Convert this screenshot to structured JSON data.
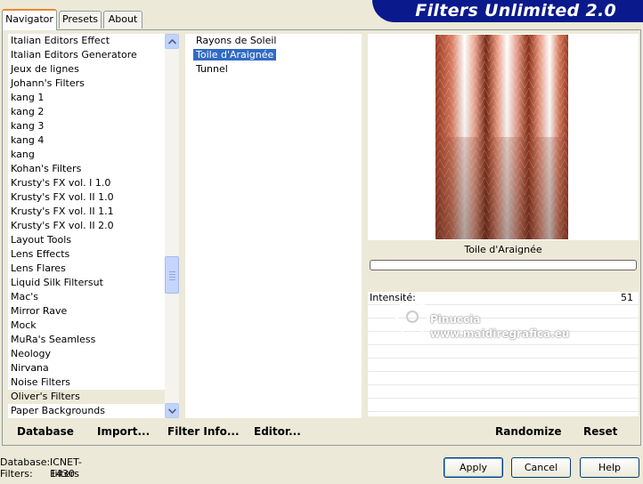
{
  "app": {
    "title": "Filters Unlimited 2.0"
  },
  "tabs": [
    {
      "label": "Navigator",
      "active": true
    },
    {
      "label": "Presets",
      "active": false
    },
    {
      "label": "About",
      "active": false
    }
  ],
  "categories": {
    "items": [
      "Italian Editors Effect",
      "Italian Editors Generatore",
      "Jeux de lignes",
      "Johann's Filters",
      "kang 1",
      "kang 2",
      "kang 3",
      "kang 4",
      "kang",
      "Kohan's Filters",
      "Krusty's FX vol. I 1.0",
      "Krusty's FX vol. II 1.0",
      "Krusty's FX vol. II 1.1",
      "Krusty's FX vol. II 2.0",
      "Layout Tools",
      "Lens Effects",
      "Lens Flares",
      "Liquid Silk Filtersut",
      "Mac's",
      "Mirror Rave",
      "Mock",
      "MuRa's Seamless",
      "Neology",
      "Nirvana",
      "Noise Filters",
      "Oliver's Filters",
      "Paper Backgrounds"
    ],
    "selected": "Oliver's Filters"
  },
  "filters": {
    "items": [
      "Rayons de Soleil",
      "Toile d'Araignée",
      "Tunnel"
    ],
    "selected": "Toile d'Araignée"
  },
  "preview": {
    "name": "Toile d'Araignée",
    "progress": 0
  },
  "params": [
    {
      "label": "Intensité:",
      "value": "51"
    }
  ],
  "watermark": {
    "line1": "Pinuccia",
    "line2": "www.maidiregrafica.eu"
  },
  "toolbar": {
    "database": "Database",
    "import": "Import...",
    "filter_info": "Filter Info...",
    "editor": "Editor...",
    "randomize": "Randomize",
    "reset": "Reset"
  },
  "status": {
    "database_label": "Database:",
    "database_value": "ICNET-Filters",
    "filters_label": "Filters:",
    "filters_value": "1430"
  },
  "buttons": {
    "apply": "Apply",
    "cancel": "Cancel",
    "help": "Help"
  },
  "colors": {
    "banner": "#0a1a8c",
    "selection": "#316ac5",
    "tab_accent": "#e68b2c"
  }
}
